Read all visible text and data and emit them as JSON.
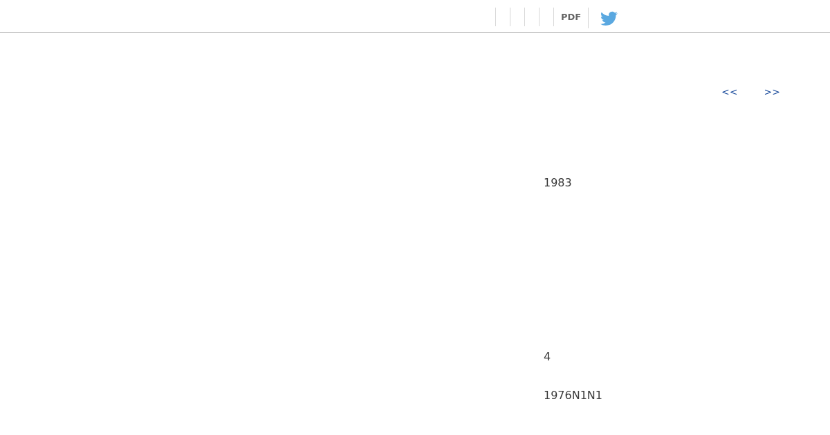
{
  "toolbar": {
    "pdf_link": "PDF"
  },
  "pager": {
    "previous": "<<",
    "next": ">>"
  },
  "content": {
    "texts": [
      "1983",
      "4",
      "1976N1N1"
    ]
  }
}
